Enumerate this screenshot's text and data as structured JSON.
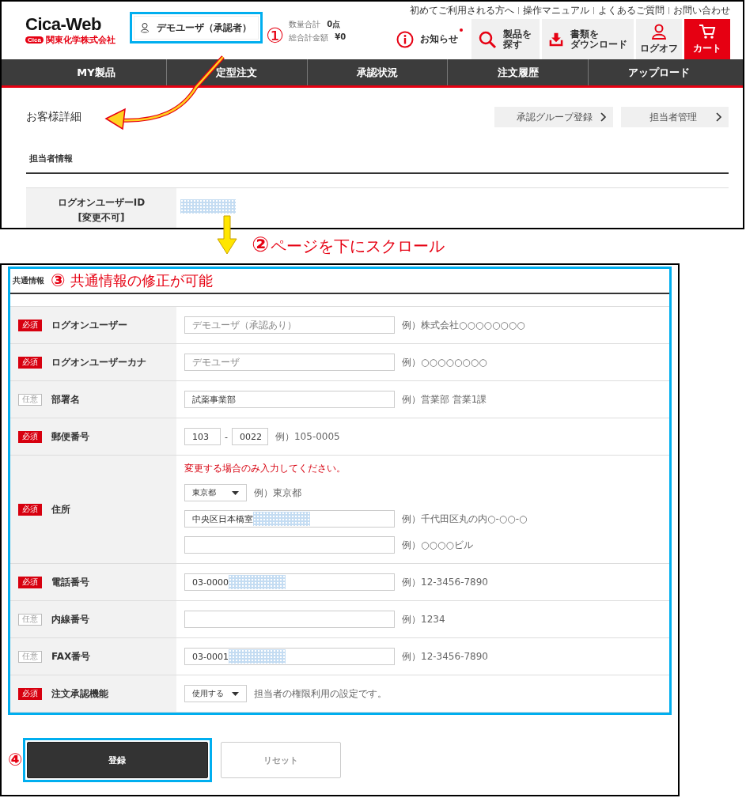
{
  "header": {
    "logo": {
      "title": "Cica-Web",
      "badge": "Cica",
      "company": "関東化学株式会社"
    },
    "user_button": "デモユーザ（承認者）",
    "totals": [
      {
        "label": "数量合計",
        "value": "0点"
      },
      {
        "label": "総合計金額",
        "value": "¥0"
      }
    ],
    "top_links": [
      "初めてご利用される方へ",
      "操作マニュアル",
      "よくあるご質問",
      "お問い合わせ"
    ],
    "actions": [
      {
        "kind": "notice",
        "label": "お知らせ",
        "unread": true
      },
      {
        "kind": "search",
        "label": [
          "製品を",
          "探す"
        ]
      },
      {
        "kind": "download",
        "label": [
          "書類を",
          "ダウンロード"
        ]
      },
      {
        "kind": "logoff",
        "label": "ログオフ"
      },
      {
        "kind": "cart",
        "label": "カート"
      }
    ]
  },
  "nav": [
    "MY製品",
    "定型注文",
    "承認状況",
    "注文履歴",
    "アップロード"
  ],
  "page": {
    "title": "お客様詳細",
    "buttons": [
      "承認グループ登録",
      "担当者管理"
    ],
    "section": "担当者情報",
    "id_row": {
      "label": "ログオンユーザーID",
      "sublabel": "[変更不可]",
      "masked": true
    }
  },
  "annotations": [
    {
      "number": "①"
    },
    {
      "number": "②",
      "text": "ページを下にスクロール"
    },
    {
      "number": "③",
      "text": "共通情報の修正が可能"
    },
    {
      "number": "④"
    }
  ],
  "form": {
    "title": "共通情報",
    "rows": [
      {
        "required": true,
        "badge": "必須",
        "label": "ログオンユーザー",
        "lines": [
          {
            "kind": "text",
            "placeholder": "デモユーザ（承認あり）",
            "hint": "例）株式会社○○○○○○○○"
          }
        ]
      },
      {
        "required": true,
        "badge": "必須",
        "label": "ログオンユーザーカナ",
        "lines": [
          {
            "kind": "text",
            "placeholder": "デモユーザ",
            "hint": "例）○○○○○○○○"
          }
        ]
      },
      {
        "required": false,
        "badge": "任意",
        "label": "部署名",
        "lines": [
          {
            "kind": "text",
            "value": "試薬事業部",
            "hint": "例）営業部 営業1課"
          }
        ]
      },
      {
        "required": true,
        "badge": "必須",
        "label": "郵便番号",
        "lines": [
          {
            "kind": "zip",
            "value": "103",
            "value2": "0022",
            "separator": "-",
            "hint": "例）105-0005"
          }
        ]
      },
      {
        "required": true,
        "badge": "必須",
        "label": "住所",
        "lines": [
          {
            "kind": "note",
            "text": "変更する場合のみ入力してください。"
          },
          {
            "kind": "select",
            "value": "東京都",
            "hint": "例）東京都"
          },
          {
            "kind": "text",
            "value": "中央区日本橋室",
            "masked": true,
            "hint": "例）千代田区丸の内○-○○-○"
          },
          {
            "kind": "text",
            "hint": "例）○○○○ビル"
          }
        ]
      },
      {
        "required": true,
        "badge": "必須",
        "label": "電話番号",
        "lines": [
          {
            "kind": "text",
            "value": "03-0000",
            "masked": true,
            "hint": "例）12-3456-7890"
          }
        ]
      },
      {
        "required": false,
        "badge": "任意",
        "label": "内線番号",
        "lines": [
          {
            "kind": "text",
            "hint": "例）1234"
          }
        ]
      },
      {
        "required": false,
        "badge": "任意",
        "label": "FAX番号",
        "lines": [
          {
            "kind": "text",
            "value": "03-0001",
            "masked": true,
            "hint": "例）12-3456-7890"
          }
        ]
      },
      {
        "required": true,
        "badge": "必須",
        "label": "注文承認機能",
        "lines": [
          {
            "kind": "select",
            "value": "使用する",
            "hint": "担当者の権限利用の設定です。"
          }
        ]
      }
    ]
  },
  "buttons": [
    {
      "label": "登録",
      "primary": true
    },
    {
      "label": "リセット",
      "primary": false
    }
  ]
}
